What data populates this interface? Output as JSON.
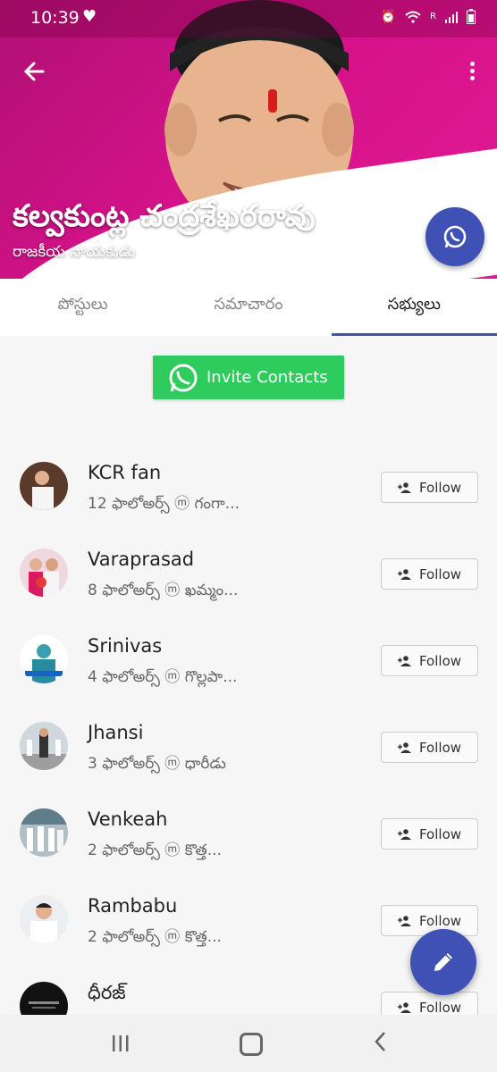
{
  "status_bar": {
    "time": "10:39",
    "signal_text": "R"
  },
  "profile": {
    "name": "కల్వకుంట్ల చంద్రశేఖరరావు",
    "role": "రాజకీయ నాయకుడు"
  },
  "tabs": [
    {
      "label": "పోస్టులు"
    },
    {
      "label": "సమాచారం"
    },
    {
      "label": "సభ్యులు"
    }
  ],
  "invite_button": {
    "label": "Invite Contacts"
  },
  "members": [
    {
      "name": "KCR fan",
      "meta": "12 ఫాలోఅర్స్ ⓜ గంగా...",
      "follow": "Follow"
    },
    {
      "name": "Varaprasad",
      "meta": "8 ఫాలోఅర్స్ ⓜ ఖమ్మం...",
      "follow": "Follow"
    },
    {
      "name": "Srinivas",
      "meta": "4 ఫాలోఅర్స్ ⓜ గొల్లపా...",
      "follow": "Follow"
    },
    {
      "name": "Jhansi",
      "meta": "3 ఫాలోఅర్స్ ⓜ ధారీడు",
      "follow": "Follow"
    },
    {
      "name": "Venkeah",
      "meta": "2 ఫాలోఅర్స్ ⓜ కొత్త...",
      "follow": "Follow"
    },
    {
      "name": "Rambabu",
      "meta": "2 ఫాలోఅర్స్ ⓜ కొత్త...",
      "follow": "Follow"
    },
    {
      "name": "ధీరజ్",
      "meta": "",
      "follow": "Follow"
    }
  ],
  "colors": {
    "hero": "#d6128a",
    "accent": "#3f51b5",
    "invite": "#2ecc5c"
  },
  "icons": [
    "back-arrow-icon",
    "more-vert-icon",
    "whatsapp-icon",
    "person-add-icon",
    "pencil-icon"
  ]
}
